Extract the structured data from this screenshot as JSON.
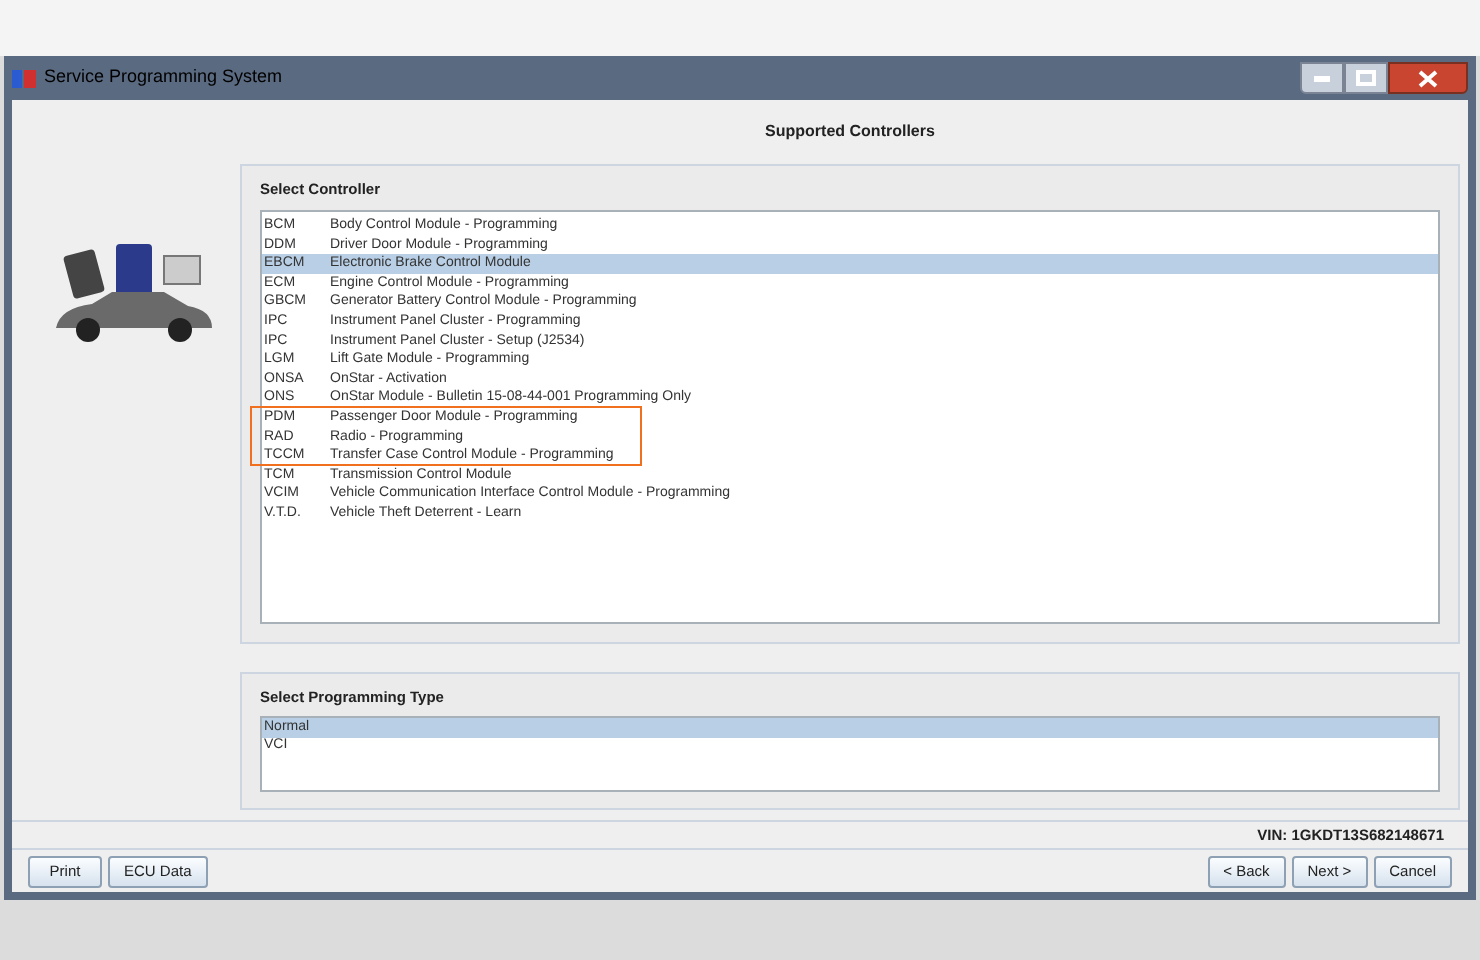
{
  "window": {
    "title": "Service Programming System"
  },
  "header": "Supported Controllers",
  "controllers": {
    "title": "Select Controller",
    "rows": [
      {
        "code": "BCM",
        "name": "Body Control Module - Programming",
        "selected": false,
        "highlighted": false
      },
      {
        "code": "DDM",
        "name": "Driver Door Module - Programming",
        "selected": false,
        "highlighted": false
      },
      {
        "code": "EBCM",
        "name": "Electronic Brake Control Module",
        "selected": true,
        "highlighted": false
      },
      {
        "code": "ECM",
        "name": "Engine Control Module - Programming",
        "selected": false,
        "highlighted": false
      },
      {
        "code": "GBCM",
        "name": "Generator Battery Control Module - Programming",
        "selected": false,
        "highlighted": false
      },
      {
        "code": "IPC",
        "name": "Instrument Panel Cluster - Programming",
        "selected": false,
        "highlighted": false
      },
      {
        "code": "IPC",
        "name": "Instrument Panel Cluster - Setup (J2534)",
        "selected": false,
        "highlighted": false
      },
      {
        "code": "LGM",
        "name": "Lift Gate Module - Programming",
        "selected": false,
        "highlighted": false
      },
      {
        "code": "ONSA",
        "name": "OnStar - Activation",
        "selected": false,
        "highlighted": false
      },
      {
        "code": "ONS",
        "name": "OnStar Module - Bulletin 15-08-44-001 Programming Only",
        "selected": false,
        "highlighted": false
      },
      {
        "code": "PDM",
        "name": "Passenger Door Module - Programming",
        "selected": false,
        "highlighted": true
      },
      {
        "code": "RAD",
        "name": "Radio - Programming",
        "selected": false,
        "highlighted": true
      },
      {
        "code": "TCCM",
        "name": "Transfer Case Control Module - Programming",
        "selected": false,
        "highlighted": true
      },
      {
        "code": "TCM",
        "name": "Transmission Control Module",
        "selected": false,
        "highlighted": false
      },
      {
        "code": "VCIM",
        "name": "Vehicle Communication Interface Control Module - Programming",
        "selected": false,
        "highlighted": false
      },
      {
        "code": "V.T.D.",
        "name": "Vehicle Theft Deterrent - Learn",
        "selected": false,
        "highlighted": false
      }
    ]
  },
  "programming_type": {
    "title": "Select Programming Type",
    "items": [
      {
        "label": "Normal",
        "selected": true
      },
      {
        "label": "VCI",
        "selected": false
      }
    ]
  },
  "vin": "VIN: 1GKDT13S682148671",
  "left_buttons": [
    "Print",
    "ECU Data"
  ],
  "right_buttons": [
    "< Back",
    "Next >",
    "Cancel"
  ]
}
